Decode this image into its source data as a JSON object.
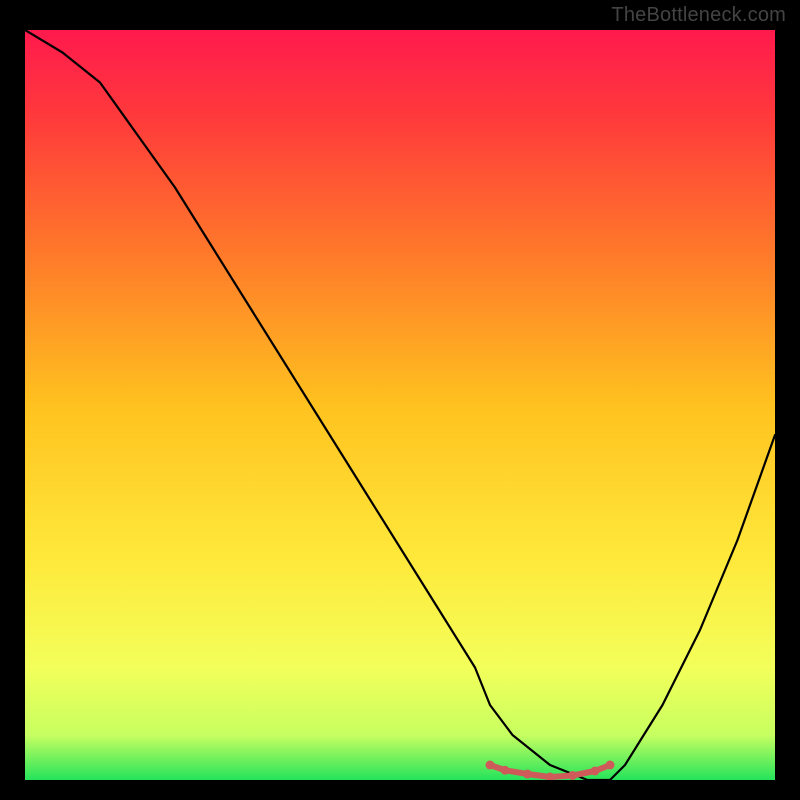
{
  "watermark": "TheBottleneck.com",
  "colors": {
    "background": "#000000",
    "watermark": "#444444",
    "curve": "#000000",
    "marker_stroke": "#cf5a5a",
    "marker_fill": "#cf5a5a",
    "gradient_stops": [
      {
        "offset": 0.0,
        "color": "#ff1a4d"
      },
      {
        "offset": 0.12,
        "color": "#ff3b3b"
      },
      {
        "offset": 0.3,
        "color": "#ff7a2a"
      },
      {
        "offset": 0.5,
        "color": "#ffc21f"
      },
      {
        "offset": 0.7,
        "color": "#ffe83a"
      },
      {
        "offset": 0.85,
        "color": "#f3ff5a"
      },
      {
        "offset": 0.94,
        "color": "#c7ff60"
      },
      {
        "offset": 1.0,
        "color": "#24e35b"
      }
    ]
  },
  "chart_data": {
    "type": "line",
    "title": "",
    "xlabel": "",
    "ylabel": "",
    "xlim": [
      0,
      100
    ],
    "ylim": [
      0,
      100
    ],
    "series": [
      {
        "name": "bottleneck-curve",
        "x": [
          0,
          5,
          10,
          15,
          20,
          25,
          30,
          35,
          40,
          45,
          50,
          55,
          60,
          62,
          65,
          70,
          75,
          78,
          80,
          85,
          90,
          95,
          100
        ],
        "values": [
          100,
          97,
          93,
          86,
          79,
          71,
          63,
          55,
          47,
          39,
          31,
          23,
          15,
          10,
          6,
          2,
          0,
          0,
          2,
          10,
          20,
          32,
          46
        ]
      }
    ],
    "markers": {
      "name": "highlight-dots",
      "x": [
        62,
        64,
        67,
        70,
        73,
        76,
        78
      ],
      "values": [
        2,
        1.3,
        0.8,
        0.4,
        0.6,
        1.2,
        2
      ]
    }
  }
}
